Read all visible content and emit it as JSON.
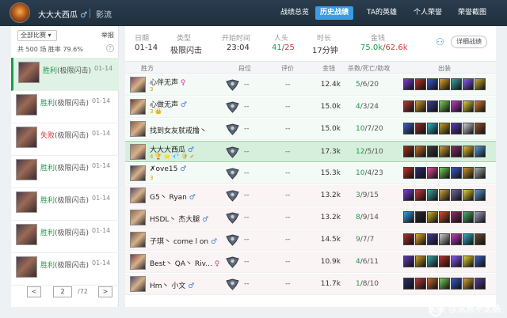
{
  "topbar": {
    "player_name": "大大大西瓜",
    "player_badge": "♂",
    "server": "影流",
    "nav": [
      "战绩总览",
      "历史战绩",
      "TA的英雄",
      "个人荣誉",
      "荣誉截图"
    ],
    "active_index": 1
  },
  "sidebar": {
    "filter_label": "全部比赛 ▾",
    "report_label": "举报",
    "summary": "共 500 场   胜率 79.6%",
    "help_icon": "help-icon",
    "matches": [
      {
        "result": "胜利",
        "mode": "(极限闪击)",
        "date": "01-14",
        "win": true
      },
      {
        "result": "胜利",
        "mode": "(极限闪击)",
        "date": "01-14",
        "win": true
      },
      {
        "result": "失败",
        "mode": "(极限闪击)",
        "date": "01-14",
        "win": false
      },
      {
        "result": "胜利",
        "mode": "(极限闪击)",
        "date": "01-14",
        "win": true
      },
      {
        "result": "胜利",
        "mode": "(极限闪击)",
        "date": "01-14",
        "win": true
      },
      {
        "result": "胜利",
        "mode": "(极限闪击)",
        "date": "01-14",
        "win": true
      },
      {
        "result": "胜利",
        "mode": "(极限闪击)",
        "date": "01-14",
        "win": true
      }
    ],
    "pager": {
      "prev": "<",
      "page": "2",
      "total": "/72",
      "next": ">"
    }
  },
  "summary": {
    "labels": {
      "date": "日期",
      "type": "类型",
      "start": "开始时间",
      "heads": "人头",
      "duration": "时长",
      "gold": "金钱"
    },
    "date": "01-14",
    "type": "极限闪击",
    "start": "23:04",
    "kills_a": "41",
    "kills_sep": "/",
    "kills_b": "25",
    "duration": "17分钟",
    "gold_a": "75.0k",
    "gold_sep": "/",
    "gold_b": "62.6k",
    "detail_button": "详细战绩"
  },
  "table": {
    "headers": [
      "胜方",
      "段位",
      "评价",
      "金钱",
      "杀数/死亡/助攻",
      "出装"
    ],
    "rows": [
      {
        "name": "心伴无声",
        "gender": "♀",
        "badges": "3",
        "rank": "--",
        "score": "--",
        "gold": "12.4k",
        "k": "5",
        "d": "6",
        "a": "20",
        "items": [
          "#7a3fd1",
          "#b8322a",
          "#3b57c9",
          "#e0a52b",
          "#3aa3a0",
          "#8b5cf6",
          "#c9b12e"
        ]
      },
      {
        "name": "心做无声",
        "gender": "♂",
        "badges": "3 👑",
        "rank": "--",
        "score": "--",
        "gold": "15.0k",
        "k": "4",
        "d": "3",
        "a": "24",
        "items": [
          "#b23a3a",
          "#d1962c",
          "#3c3c8f",
          "#7bd15a",
          "#c23ac9",
          "#e5d23a",
          "#d67a2b"
        ]
      },
      {
        "name": "找到女友就戒撸丶",
        "gender": "",
        "badges": "",
        "rank": "--",
        "score": "--",
        "gold": "15.0k",
        "k": "10",
        "d": "7",
        "a": "20",
        "items": [
          "#3a5fbf",
          "#8d2b2b",
          "#2bb1c9",
          "#c9a12b",
          "#5f3ab8",
          "#d1d1d1",
          "#9a4f2c"
        ]
      },
      {
        "name": "大大大西瓜",
        "gender": "♂",
        "badges": "4 🏆 ⭐ 💎 🛡 ✔",
        "rank": "--",
        "score": "--",
        "gold": "17.3k",
        "k": "12",
        "d": "5",
        "a": "10",
        "items": [
          "#9c2f22",
          "#c06a2b",
          "#3b3b3b",
          "#d8a43a",
          "#8e2d6a",
          "#e6c13a",
          "#5a9bd8"
        ],
        "me": true
      },
      {
        "name": "✗ove15",
        "gender": "♂",
        "badges": "3",
        "rank": "--",
        "score": "--",
        "gold": "15.3k",
        "k": "10",
        "d": "4",
        "a": "23",
        "items": [
          "#b8322a",
          "#2d2d6a",
          "#e34c9c",
          "#7bd15a",
          "#3b57c9",
          "#d1962c",
          "#b0b0b0"
        ]
      },
      {
        "name": "G5丶 Ryan",
        "gender": "♂",
        "badges": "",
        "rank": "--",
        "score": "--",
        "gold": "13.2k",
        "k": "3",
        "d": "9",
        "a": "15",
        "items": [
          "#7a3fd1",
          "#c23a3a",
          "#3aa3a0",
          "#d8a43a",
          "#6b6b9e",
          "#e5d23a",
          "#5a9bd8"
        ]
      },
      {
        "name": "HSDL丶 杰大腿",
        "gender": "♂",
        "badges": "",
        "rank": "--",
        "score": "--",
        "gold": "13.2k",
        "k": "8",
        "d": "9",
        "a": "14",
        "items": [
          "#3a9ce3",
          "#2a2a2a",
          "#c9b12e",
          "#d34a2a",
          "#8e2d6a",
          "#4bb06a",
          "#a0a0c8"
        ]
      },
      {
        "name": "子琪丶 come l on",
        "gender": "♂",
        "badges": "",
        "rank": "--",
        "score": "--",
        "gold": "14.5k",
        "k": "9",
        "d": "7",
        "a": "7",
        "items": [
          "#a3322a",
          "#e0a52b",
          "#3b3b8f",
          "#d1d1d1",
          "#c23ac9",
          "#2bb1c9",
          "#6a4a2a"
        ]
      },
      {
        "name": "Best丶 QA丶 Riv...",
        "gender": "♀",
        "badges": "",
        "rank": "--",
        "score": "--",
        "gold": "10.9k",
        "k": "4",
        "d": "6",
        "a": "11",
        "items": [
          "#5f3ab8",
          "#c9a12b",
          "#3aa3a0",
          "#b8322a",
          "#8b5cf6",
          "#e5d23a",
          "#3a5fbf"
        ]
      },
      {
        "name": "Hm丶 小文",
        "gender": "♂",
        "badges": "",
        "rank": "--",
        "score": "--",
        "gold": "11.7k",
        "k": "1",
        "d": "8",
        "a": "10",
        "items": [
          "#2d2d6a",
          "#b23a3a",
          "#c06a2b",
          "#7bd15a",
          "#3b57c9",
          "#d8a43a",
          "#5a3a9e"
        ]
      }
    ]
  },
  "watermark": "头条 @东京不太热"
}
